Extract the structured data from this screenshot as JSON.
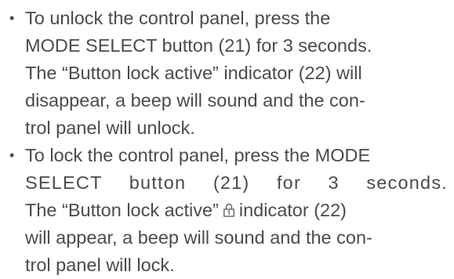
{
  "items": [
    {
      "bullet": "•",
      "lines": [
        "To unlock the control panel, press the",
        "MODE SELECT button (21) for 3 seconds.",
        "The “Button lock active” indicator (22) will",
        "disappear, a beep will sound and the con-",
        "trol panel will unlock."
      ]
    },
    {
      "bullet": "•",
      "lines": [
        "To lock the control panel, press the MODE",
        "SELECT button (21) for 3 seconds.",
        "The “Button lock active”",
        "indicator (22)",
        "will appear, a beep will sound and the con-",
        "trol panel will lock."
      ],
      "icon": "button-lock-icon"
    }
  ]
}
